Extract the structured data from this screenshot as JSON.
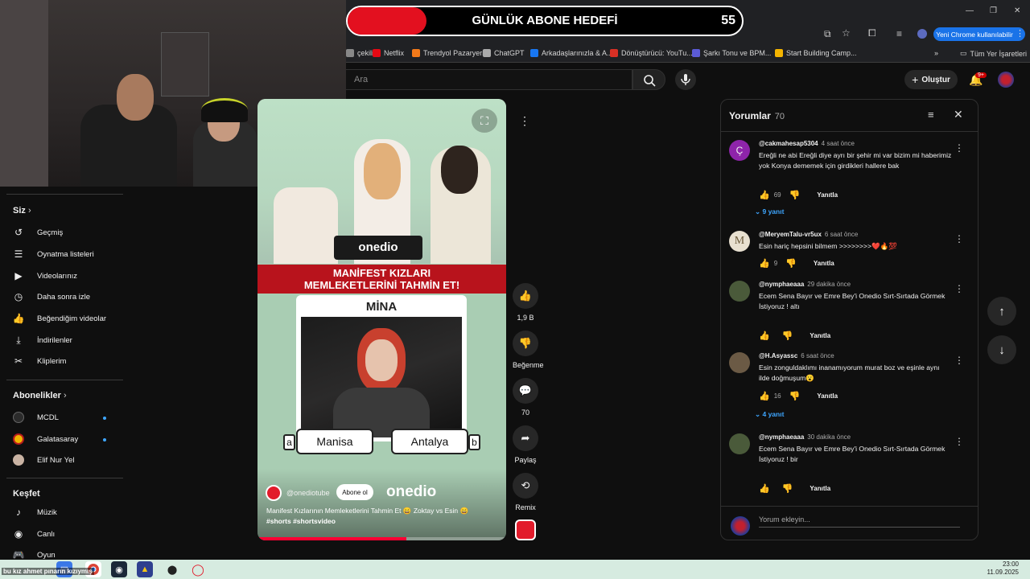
{
  "browser": {
    "bookmarks": [
      {
        "label": "çekiliş",
        "color": "#888"
      },
      {
        "label": "Netflix",
        "color": "#e50914"
      },
      {
        "label": "Trendyol Pazaryeri",
        "color": "#f27a1a"
      },
      {
        "label": "ChatGPT",
        "color": "#aaa"
      },
      {
        "label": "Arkadaşlarınızla & A...",
        "color": "#1877f2"
      },
      {
        "label": "Dönüştürücü: YouTu...",
        "color": "#d93025"
      },
      {
        "label": "Şarkı Tonu ve BPM...",
        "color": "#5b5bd6"
      },
      {
        "label": "Start Building Camp...",
        "color": "#f4b400"
      }
    ],
    "all_bookmarks": "Tüm Yer İşaretleri",
    "account_button": "Yeni Chrome kullanılabilir"
  },
  "goal": {
    "title": "GÜNLÜK ABONE HEDEFİ",
    "count": "55",
    "progress": 0.2
  },
  "header": {
    "search_placeholder": "Ara",
    "create_label": "Oluştur",
    "notification_badge": "9+"
  },
  "sidebar": {
    "you_title": "Siz",
    "you_items": [
      {
        "label": "Geçmiş",
        "icon": "history-icon",
        "glyph": "↺"
      },
      {
        "label": "Oynatma listeleri",
        "icon": "playlist-icon",
        "glyph": "☰"
      },
      {
        "label": "Videolarınız",
        "icon": "video-icon",
        "glyph": "▶"
      },
      {
        "label": "Daha sonra izle",
        "icon": "clock-icon",
        "glyph": "◷"
      },
      {
        "label": "Beğendiğim videolar",
        "icon": "thumb-up-icon",
        "glyph": "👍"
      },
      {
        "label": "İndirilenler",
        "icon": "download-icon",
        "glyph": "⤓"
      },
      {
        "label": "Kliplerim",
        "icon": "scissors-icon",
        "glyph": "✂"
      }
    ],
    "subs_title": "Abonelikler",
    "subs": [
      {
        "label": "MCDL",
        "color": "#2b2b2b"
      },
      {
        "label": "Galatasaray",
        "color": "#f0b400"
      },
      {
        "label": "Elif Nur Yel",
        "color": "#c9b3a3"
      }
    ],
    "explore_title": "Keşfet",
    "explore_items": [
      {
        "label": "Müzik",
        "icon": "music-icon",
        "glyph": "♪"
      },
      {
        "label": "Canlı",
        "icon": "live-icon",
        "glyph": "◉"
      },
      {
        "label": "Oyun",
        "icon": "game-icon",
        "glyph": "🎮"
      }
    ]
  },
  "video": {
    "banner_line1": "MANİFEST KIZLARI",
    "banner_line2": "MEMLEKETLERİNİ TAHMİN ET!",
    "card_name": "MİNA",
    "option_a_letter": "a",
    "option_a": "Manisa",
    "option_b_letter": "b",
    "option_b": "Antalya",
    "channel": "@onediotube",
    "subscribe": "Abone ol",
    "title": "Manifest Kızlarının Memleketlerini Tahmin Et 😄 Zoktay vs Esin 😄",
    "hashtags": "#shorts #shortsvideo",
    "progress": 0.6,
    "watermark": "onedio"
  },
  "actions": {
    "like_count": "1,9 B",
    "dislike_label": "Beğenme",
    "comment_count": "70",
    "share_label": "Paylaş",
    "remix_label": "Remix"
  },
  "comments": {
    "title": "Yorumlar",
    "count": "70",
    "add_placeholder": "Yorum ekleyin...",
    "reply_label": "Yanıtla",
    "items": [
      {
        "author": "@cakmahesap5304",
        "time": "4 saat önce",
        "text": "Ereğli ne abi Ereğli diye ayrı bir şehir mi var bizim mi haberimiz yok Konya dememek için girdikleri hallere bak",
        "likes": "69",
        "replies": "9 yanıt",
        "avatar_letter": "Ç",
        "avatar_color": "#8e24aa"
      },
      {
        "author": "@MeryemTalu-vr5ux",
        "time": "6 saat önce",
        "text": "Esin hariç hepsini bilmem >>>>>>>>❤️🔥💯",
        "likes": "9",
        "replies": "",
        "avatar_letter": "M",
        "avatar_color": "#e8e0d0"
      },
      {
        "author": "@nymphaeaaa",
        "time": "29 dakika önce",
        "text": "Ecem Sena Bayır ve Emre Bey'i Onedio Sırt-Sırtada Görmek İstiyoruz ! altı",
        "likes": "",
        "replies": "",
        "avatar_letter": "",
        "avatar_color": "#4a5a3a"
      },
      {
        "author": "@H.Asyassc",
        "time": "6 saat önce",
        "text": "Esin zonguldaklımı inanamıyorum murat boz ve eşinle aynı ilde doğmuşum😮",
        "likes": "16",
        "replies": "4 yanıt",
        "avatar_letter": "",
        "avatar_color": "#6b5a45"
      },
      {
        "author": "@nymphaeaaa",
        "time": "30 dakika önce",
        "text": "Ecem Sena Bayır ve Emre Bey'i Onedio Sırt-Sırtada Görmek İstiyoruz ! bir",
        "likes": "",
        "replies": "",
        "avatar_letter": "",
        "avatar_color": "#4a5a3a"
      }
    ]
  },
  "taskbar": {
    "ticker": "bu kız ahmet pınarın kızıymış",
    "time": "23:00",
    "date": "11.09.2025"
  }
}
